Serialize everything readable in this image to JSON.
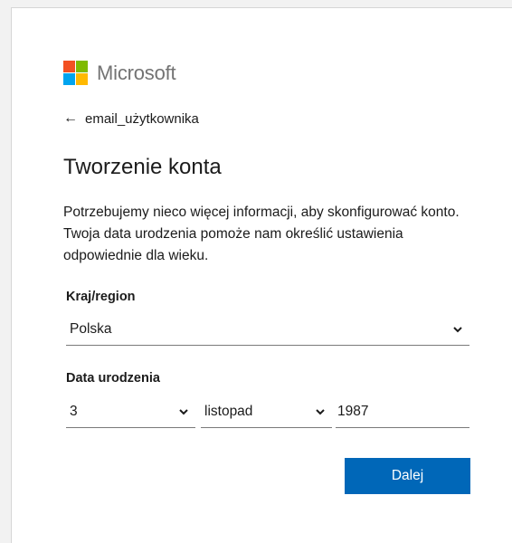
{
  "brand": {
    "name": "Microsoft",
    "colors": {
      "red": "#f25022",
      "green": "#7fba00",
      "blue": "#00a4ef",
      "yellow": "#ffb900"
    }
  },
  "back": {
    "icon": "back-arrow-icon",
    "glyph": "←",
    "label": "email_użytkownika"
  },
  "title": "Tworzenie konta",
  "description": "Potrzebujemy nieco więcej informacji, aby skonfigurować konto. Twoja data urodzenia pomoże nam określić ustawienia odpowiednie dla wieku.",
  "country": {
    "label": "Kraj/region",
    "value": "Polska"
  },
  "birthdate": {
    "label": "Data urodzenia",
    "day": "3",
    "month": "listopad",
    "year": "1987"
  },
  "next_button": {
    "label": "Dalej",
    "color": "#0067b8"
  }
}
